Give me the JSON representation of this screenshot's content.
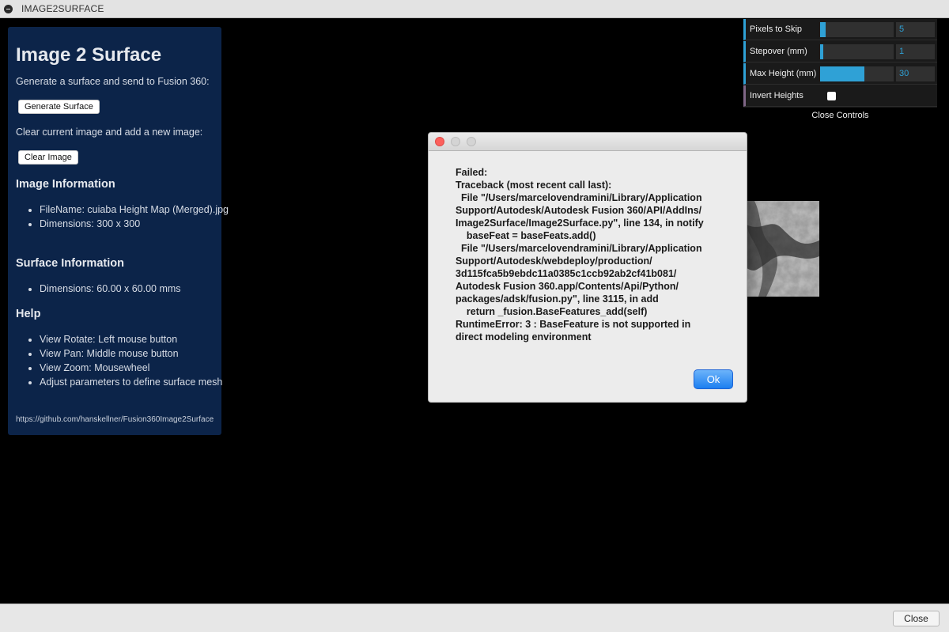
{
  "window": {
    "title": "IMAGE2SURFACE"
  },
  "info": {
    "heading": "Image 2 Surface",
    "generate_prompt": "Generate a surface and send to Fusion 360:",
    "generate_button": "Generate Surface",
    "clear_prompt": "Clear current image and add a new image:",
    "clear_button": "Clear Image",
    "image_info": {
      "heading": "Image Information",
      "items": [
        "FileName: cuiaba Height Map (Merged).jpg",
        "Dimensions: 300 x 300"
      ]
    },
    "surface_info": {
      "heading": "Surface Information",
      "items": [
        "Dimensions: 60.00 x 60.00 mms"
      ]
    },
    "help": {
      "heading": "Help",
      "items": [
        "View Rotate: Left mouse button",
        "View Pan: Middle mouse button",
        "View Zoom: Mousewheel",
        "Adjust parameters to define surface mesh"
      ]
    },
    "link": "https://github.com/hanskellner/Fusion360Image2Surface"
  },
  "controls": {
    "pixels_to_skip": {
      "label": "Pixels to Skip",
      "value": "5",
      "fill": 0.08
    },
    "stepover": {
      "label": "Stepover (mm)",
      "value": "1",
      "fill": 0.04
    },
    "max_height": {
      "label": "Max Height (mm)",
      "value": "30",
      "fill": 0.6
    },
    "invert_heights": {
      "label": "Invert Heights",
      "checked": false
    },
    "close_label": "Close Controls",
    "accent": "#2fa1d6"
  },
  "dialog": {
    "message": "Failed:\nTraceback (most recent call last):\n  File \"/Users/marcelovendramini/Library/Application\nSupport/Autodesk/Autodesk Fusion 360/API/AddIns/\nImage2Surface/Image2Surface.py\", line 134, in notify\n    baseFeat = baseFeats.add()\n  File \"/Users/marcelovendramini/Library/Application\nSupport/Autodesk/webdeploy/production/\n3d115fca5b9ebdc11a0385c1ccb92ab2cf41b081/\nAutodesk Fusion 360.app/Contents/Api/Python/\npackages/adsk/fusion.py\", line 3115, in add\n    return _fusion.BaseFeatures_add(self)\nRuntimeError: 3 : BaseFeature is not supported in\ndirect modeling environment",
    "ok_label": "Ok"
  },
  "footer": {
    "close_label": "Close"
  }
}
